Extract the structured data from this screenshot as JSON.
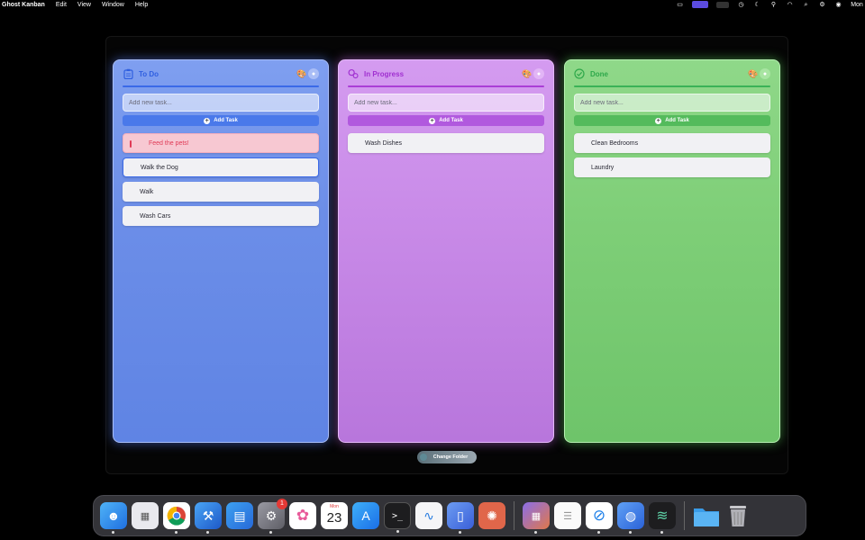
{
  "menubar": {
    "app_name": "Ghost Kanban",
    "menus": [
      "Edit",
      "View",
      "Window",
      "Help"
    ],
    "clock": "Mon"
  },
  "board": {
    "columns": [
      {
        "title": "To Do",
        "placeholder": "Add new task...",
        "add_label": "Add Task",
        "accent": "#3a69e8",
        "tasks": [
          "Feed the pets!",
          "Walk the Dog",
          "Walk",
          "Wash Cars"
        ]
      },
      {
        "title": "In Progress",
        "placeholder": "Add new task...",
        "add_label": "Add Task",
        "accent": "#aa3ed6",
        "tasks": [
          "Wash Dishes"
        ]
      },
      {
        "title": "Done",
        "placeholder": "Add new task...",
        "add_label": "Add Task",
        "accent": "#3bb257",
        "tasks": [
          "Clean Bedrooms",
          "Laundry"
        ]
      }
    ],
    "change_folder_label": "Change Folder"
  },
  "dock": {
    "settings_badge": "1",
    "calendar_month": "Mon",
    "calendar_day": "23",
    "apps": [
      "finder-icon",
      "launchpad-icon",
      "chrome-icon",
      "xcode-icon",
      "files-icon",
      "system-settings-icon",
      "photos-icon",
      "calendar-icon",
      "app-store-icon",
      "terminal-icon",
      "freeform-icon",
      "simulator-icon",
      "claude-icon",
      "screens-icon",
      "notes-icon",
      "safari-icon",
      "ghost-kanban-icon",
      "stack-icon",
      "downloads-folder-icon",
      "trash-icon"
    ]
  }
}
